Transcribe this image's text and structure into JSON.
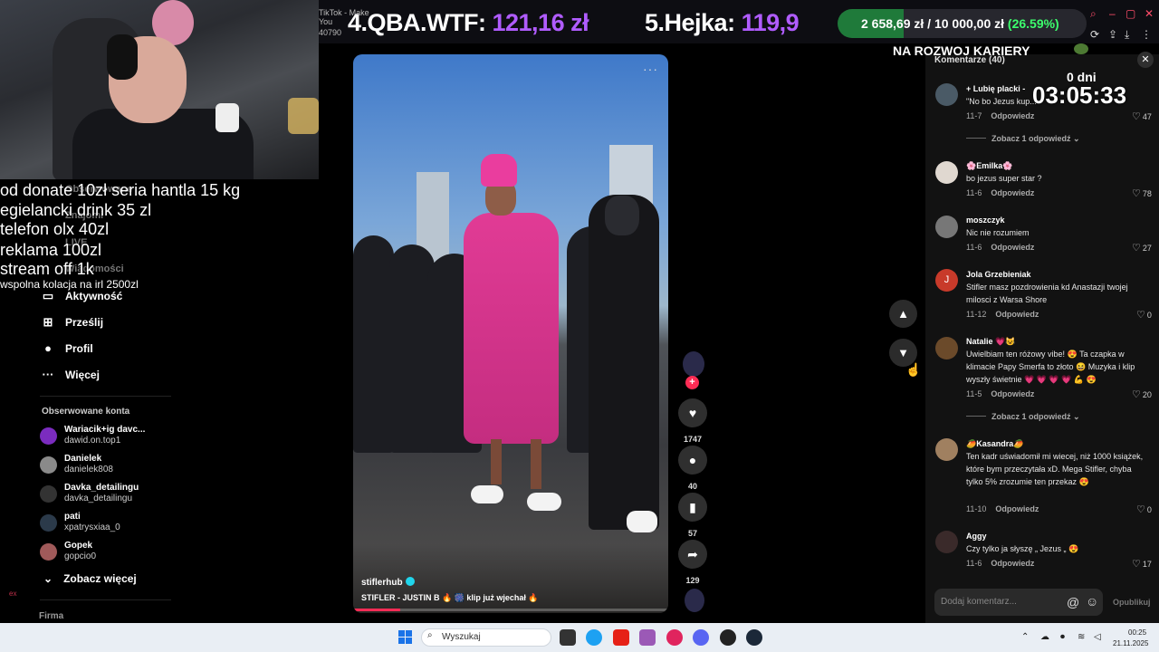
{
  "stream_banner": {
    "tab_title": "TikTok - Make You",
    "tab_id": "40790",
    "rank4_label": "4.QBA.WTF:",
    "rank4_amount": "121,16 zł",
    "rank5_label": "5.Hejka:",
    "rank5_amount": "119,9",
    "goal_current": "2 658,69 zł",
    "goal_target": "10 000,00 zł",
    "goal_percent": "(26.59%)",
    "goal_progress": 0.2659
  },
  "overlay": {
    "career_text": "NA ROZWOJ KARIERY",
    "timer_days": "0 dni",
    "timer_time": "03:05:33",
    "donate_lines": [
      "od donate 10zł seria hantla 15 kg",
      "egielancki drink 35 zl",
      "telefon olx 40zl",
      "reklama 100zl",
      "stream off 1k",
      "wspolna kolacja na irl 2500zl"
    ],
    "side_label": "ex"
  },
  "sidebar": {
    "menu_ghost": [
      "Obserwowane",
      "Znajomi",
      "LIVE",
      "Wiadomości"
    ],
    "menu": [
      {
        "label": "Aktywność",
        "icon": "activity-icon"
      },
      {
        "label": "Prześlij",
        "icon": "upload-icon"
      },
      {
        "label": "Profil",
        "icon": "profile-icon"
      },
      {
        "label": "Więcej",
        "icon": "more-icon"
      }
    ],
    "followed_title": "Obserwowane konta",
    "followed": [
      {
        "name": "Wariacik+ig davc...",
        "handle": "dawid.on.top1"
      },
      {
        "name": "Danielek",
        "handle": "danielek808"
      },
      {
        "name": "Davka_detailingu",
        "handle": "davka_detailingu"
      },
      {
        "name": "pati",
        "handle": "xpatrysxiaa_0"
      },
      {
        "name": "Gopek",
        "handle": "gopcio0"
      }
    ],
    "see_more": "Zobacz więcej",
    "firma": "Firma"
  },
  "video": {
    "author": "stiflerhub",
    "caption": "STIFLER - JUSTIN B 🔥 🎆 klip już wjechał 🔥",
    "progress": 0.15,
    "more": "···"
  },
  "actions": {
    "likes": "1747",
    "comments": "40",
    "saves": "57",
    "shares": "129"
  },
  "comments": {
    "title": "Komentarze (40)",
    "reply_label": "Odpowiedz",
    "items": [
      {
        "name": "+ Lubię placki -",
        "text": "\"No bo Jezus kup...",
        "date": "11-7",
        "likes": "47"
      },
      {
        "name": "🌸Emilka🌸",
        "text": "bo jezus super star ?",
        "date": "11-6",
        "likes": "78"
      },
      {
        "name": "moszczyk",
        "text": "Nic nie rozumiem",
        "date": "11-6",
        "likes": "27"
      },
      {
        "name": "Jola Grzebieniak",
        "text": "Stifler masz pozdrowienia kd Anastazji twojej milosci z Warsa Shore",
        "date": "11-12",
        "likes": "0"
      },
      {
        "name": "Natalie 💗😺",
        "text": "Uwielbiam ten różowy vibe! 😍 Ta czapka w klimacie Papy Smerfa to złoto 😆 Muzyka i klip wyszły świetnie 💗 💗 💗 💗 💪 😍",
        "date": "11-5",
        "likes": "20"
      },
      {
        "name": "🥭Kasandra🥭",
        "text": "Ten kadr uświadomił mi wiecej, niż 1000 książek, które bym przeczytała xD. Mega Stifler, chyba tylko 5% zrozumie ten przekaz 😍",
        "date": "11-10",
        "likes": "0"
      },
      {
        "name": "Aggy",
        "text": "Czy tylko ja słyszę „ Jezus „ 😍",
        "date": "11-6",
        "likes": "17"
      }
    ],
    "thread1": "Zobacz 1 odpowiedź",
    "thread2": "Zobacz 1 odpowiedź",
    "input_placeholder": "Dodaj komentarz...",
    "post_label": "Opublikuj",
    "avatar_initial_jola": "J"
  },
  "taskbar": {
    "search_label": "Wyszukaj",
    "time": "00:25",
    "date": "21.11.2025"
  },
  "colors": {
    "accent_purple": "#b05cff",
    "tiktok_red": "#fe2c55",
    "goal_green": "#3cff6d"
  }
}
